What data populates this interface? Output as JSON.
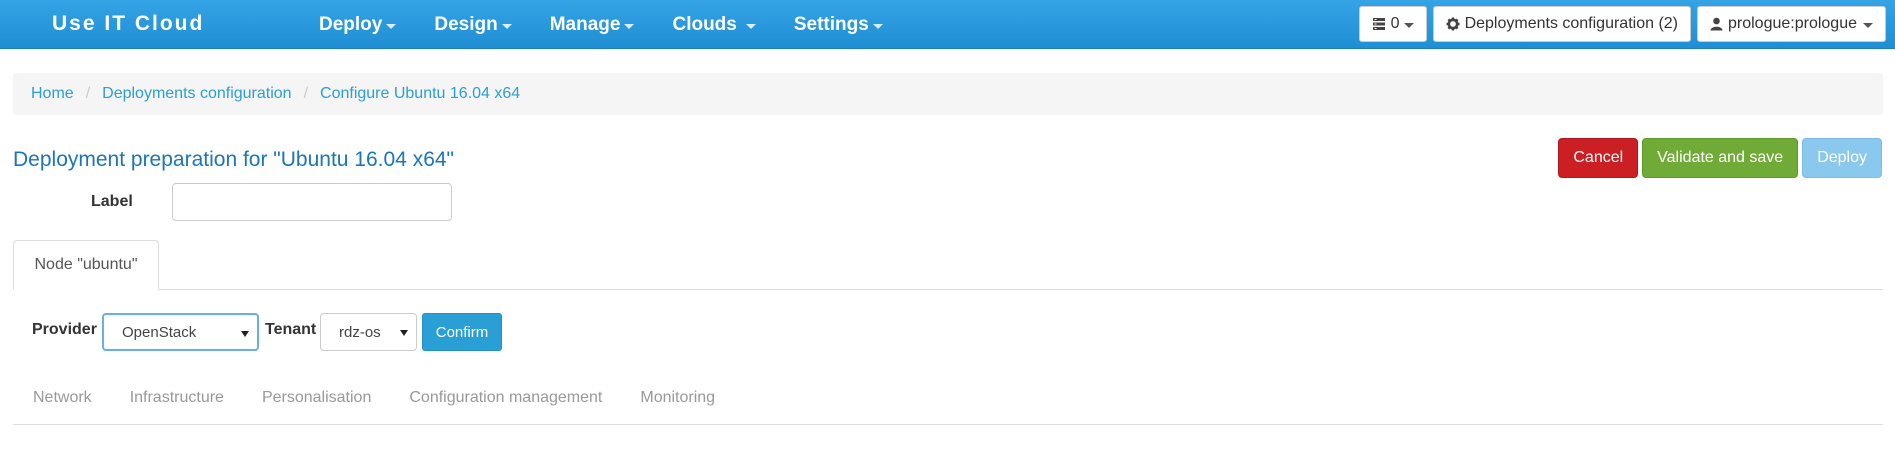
{
  "navbar": {
    "brand": "Use IT Cloud",
    "menu": [
      {
        "label": "Deploy"
      },
      {
        "label": "Design"
      },
      {
        "label": "Manage"
      },
      {
        "label": "Clouds"
      },
      {
        "label": "Settings"
      }
    ],
    "servers_count": "0",
    "deployments_config": "Deployments configuration (2)",
    "user": "prologue:prologue"
  },
  "breadcrumb": {
    "home": "Home",
    "deployments_configuration": "Deployments configuration",
    "current": "Configure Ubuntu 16.04 x64"
  },
  "page": {
    "title": "Deployment preparation for \"Ubuntu 16.04 x64\"",
    "label_field_label": "Label",
    "label_value": ""
  },
  "actions": {
    "cancel": "Cancel",
    "validate_save": "Validate and save",
    "deploy": "Deploy"
  },
  "node_tab": {
    "label": "Node \"ubuntu\""
  },
  "provider_row": {
    "provider_label": "Provider",
    "provider_value": "OpenStack",
    "tenant_label": "Tenant",
    "tenant_value": "rdz-os",
    "confirm": "Confirm"
  },
  "sub_tabs": [
    {
      "label": "Network"
    },
    {
      "label": "Infrastructure"
    },
    {
      "label": "Personalisation"
    },
    {
      "label": "Configuration management"
    },
    {
      "label": "Monitoring"
    }
  ],
  "colors": {
    "navbar": "#2196d9",
    "link": "#2a9fd6",
    "title": "#1b75bb",
    "cancel": "#cc1f24",
    "save": "#70ab37",
    "deploy": "#8ac8ee"
  }
}
